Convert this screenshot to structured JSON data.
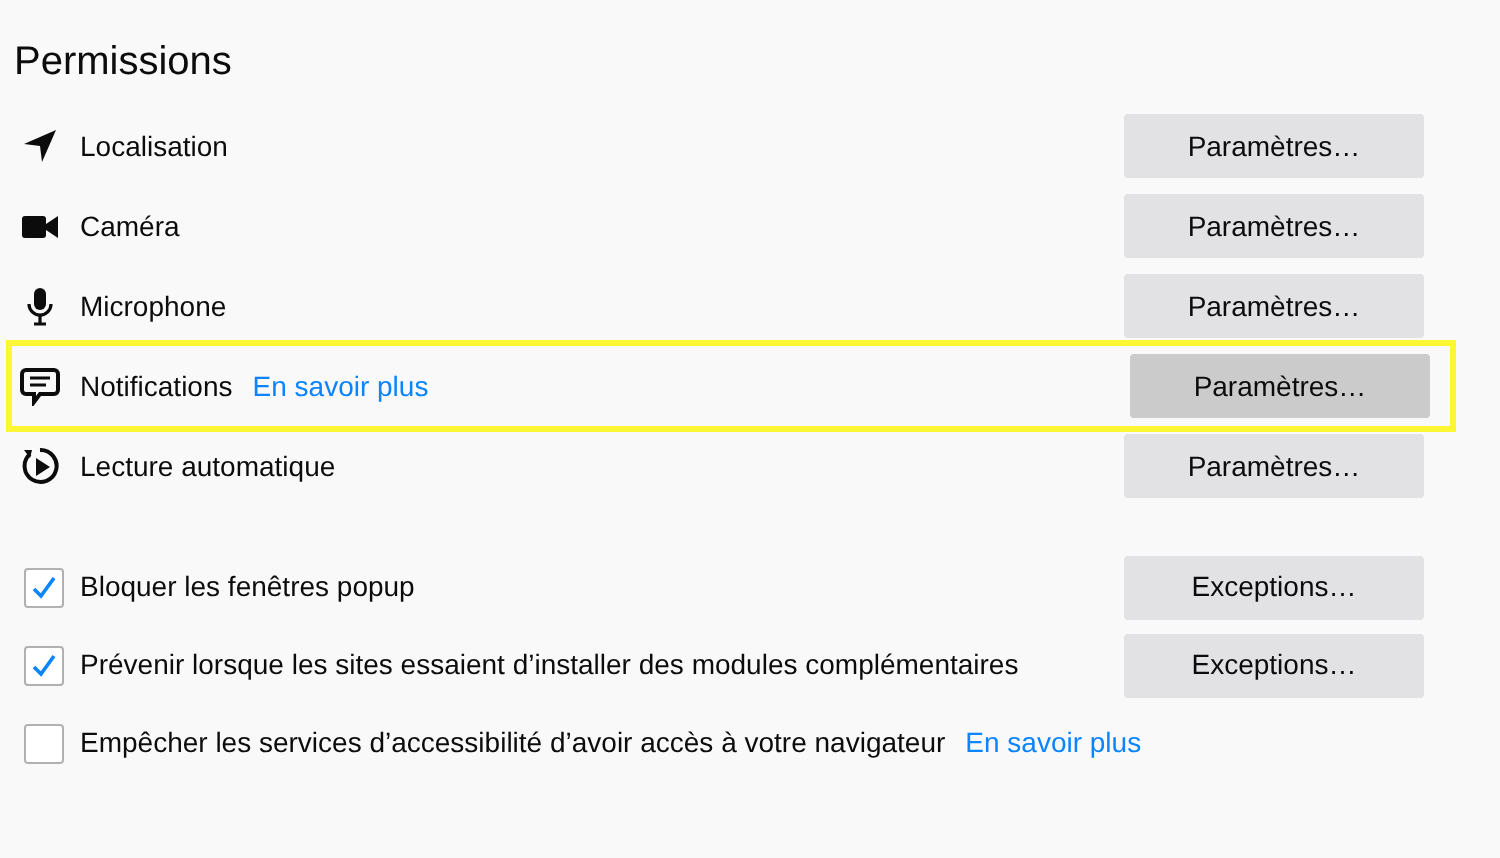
{
  "title": "Permissions",
  "permissions": [
    {
      "kind": "location",
      "label": "Localisation",
      "button": "Paramètres…",
      "highlighted": false
    },
    {
      "kind": "camera",
      "label": "Caméra",
      "button": "Paramètres…",
      "highlighted": false
    },
    {
      "kind": "microphone",
      "label": "Microphone",
      "button": "Paramètres…",
      "highlighted": false
    },
    {
      "kind": "notifications",
      "label": "Notifications",
      "link": "En savoir plus",
      "button": "Paramètres…",
      "highlighted": true
    },
    {
      "kind": "autoplay",
      "label": "Lecture automatique",
      "button": "Paramètres…",
      "highlighted": false
    }
  ],
  "options": [
    {
      "label": "Bloquer les fenêtres popup",
      "checked": true,
      "button": "Exceptions…"
    },
    {
      "label": "Prévenir lorsque les sites essaient d’installer des modules complémentaires",
      "checked": true,
      "button": "Exceptions…"
    },
    {
      "label": "Empêcher les services d’accessibilité d’avoir accès à votre navigateur",
      "checked": false,
      "link": "En savoir plus"
    }
  ]
}
